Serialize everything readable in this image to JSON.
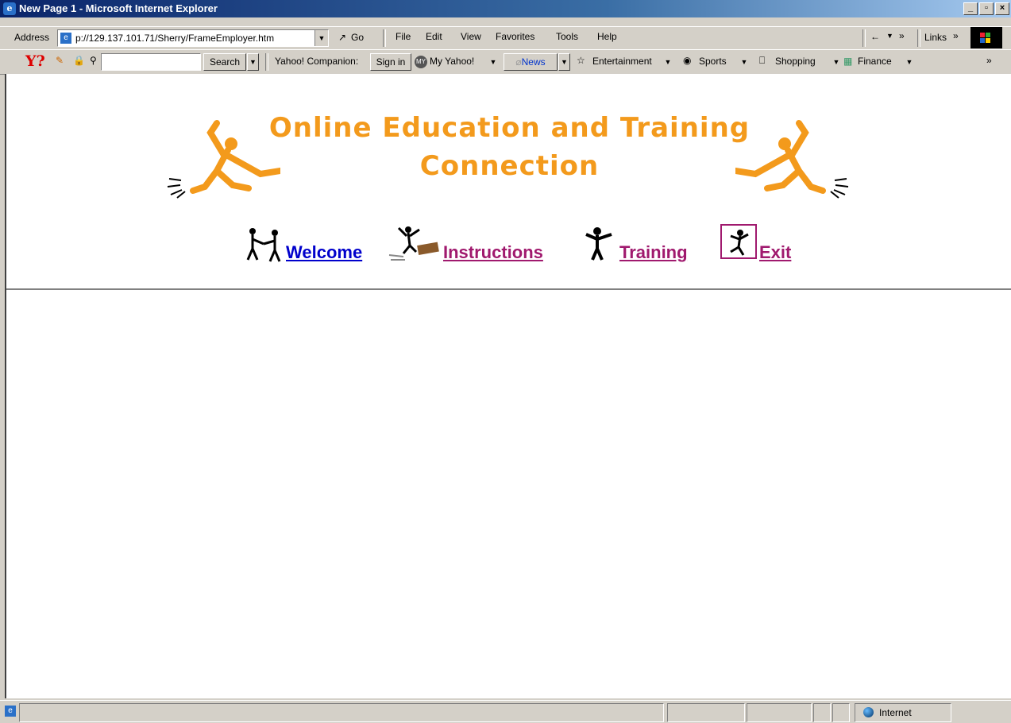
{
  "window": {
    "title": "New Page 1 - Microsoft Internet Explorer",
    "controls": [
      "_",
      " ",
      "×"
    ]
  },
  "address_bar": {
    "label": "Address",
    "url": "p://129.137.101.71/Sherry/FrameEmployer.htm",
    "go_label": "Go",
    "links_label": "Links"
  },
  "menu": [
    "File",
    "Edit",
    "View",
    "Favorites",
    "Tools",
    "Help"
  ],
  "yahoo_toolbar": {
    "logo": "Y?",
    "search_button": "Search",
    "search_value": "",
    "companion_label": "Yahoo! Companion:",
    "sign_in": "Sign in",
    "items": [
      "My Yahoo!",
      "News",
      "Entertainment",
      "Sports",
      "Shopping",
      "Finance"
    ],
    "more": "»"
  },
  "page": {
    "banner_line1": "Online Education and Training",
    "banner_line2": "Connection",
    "nav": [
      {
        "label": "Welcome",
        "color": "#0000cc"
      },
      {
        "label": "Instructions",
        "color": "#a0196e"
      },
      {
        "label": "Training",
        "color": "#a0196e"
      },
      {
        "label": "Exit",
        "color": "#a0196e"
      }
    ],
    "banner_color": "#f39a1c"
  },
  "status_bar": {
    "zone": "Internet"
  }
}
